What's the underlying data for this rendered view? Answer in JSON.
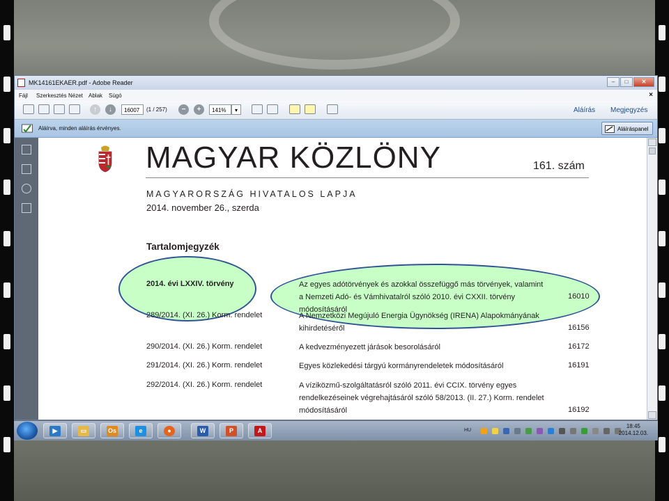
{
  "window": {
    "title": "MK14161EKAER.pdf - Adobe Reader",
    "controls": [
      "–",
      "□",
      "✕"
    ]
  },
  "menu": {
    "items": [
      "Fájl",
      "Szerkesztés",
      "Nézet",
      "Ablak",
      "Súgó"
    ],
    "close": "×"
  },
  "toolbar": {
    "page_value": "16007",
    "page_count": "(1 / 257)",
    "zoom_value": "141%",
    "zoom_arrow": "▾",
    "sign_label": "Aláírás",
    "comment_label": "Megjegyzés",
    "minus": "−",
    "plus": "+"
  },
  "signature_bar": {
    "message": "Aláírva, minden aláírás érvényes.",
    "panel_button": "Aláíráspanel"
  },
  "document": {
    "title": "MAGYAR KÖZLÖNY",
    "issue": "161. szám",
    "subtitle": "MAGYARORSZÁG HIVATALOS LAPJA",
    "date": "2014. november 26., szerda",
    "toc_heading": "Tartalomjegyzék",
    "rows": [
      {
        "left": "2014. évi LXXIV. törvény",
        "right": [
          "Az egyes adótörvények és azokkal összefüggő más törvények, valamint",
          "a Nemzeti Adó- és Vámhivatalról szóló 2010. évi CXXII. törvény módosításáról"
        ],
        "page": "16010"
      },
      {
        "left": "289/2014. (XI. 26.) Korm. rendelet",
        "right": [
          "A Nemzetközi Megújuló Energia Ügynökség (IRENA) Alapokmányának",
          "kihirdetéséről"
        ],
        "page": "16156"
      },
      {
        "left": "290/2014. (XI. 26.) Korm. rendelet",
        "right": [
          "A kedvezményezett járások besorolásáról"
        ],
        "page": "16172"
      },
      {
        "left": "291/2014. (XI. 26.) Korm. rendelet",
        "right": [
          "Egyes közlekedési tárgyú kormányrendeletek módosításáról"
        ],
        "page": "16191"
      },
      {
        "left": "292/2014. (XI. 26.) Korm. rendelet",
        "right": [
          "A víziközmű-szolgáltatásról szóló 2011. évi CCIX. törvény egyes",
          "rendelkezéseinek végrehajtásáról szóló 58/2013. (II. 27.) Korm. rendelet",
          "módosításáról"
        ],
        "page": "16192"
      }
    ]
  },
  "taskbar": {
    "apps": [
      "media-player-icon",
      "file-explorer-icon",
      "outlook-icon",
      "internet-explorer-icon",
      "firefox-icon",
      "word-icon",
      "powerpoint-icon",
      "acrobat-icon"
    ],
    "app_glyphs": [
      "▶",
      "▭",
      "Os",
      "e",
      "●",
      "W",
      "P",
      "A"
    ],
    "language": "HU",
    "time": "18:45",
    "date": "2014.12.03."
  },
  "colors": {
    "highlight_fill": "#99ff99",
    "highlight_border": "#2f5597",
    "nav_panel": "#5f6875",
    "signature_bar": "#b4cde9"
  }
}
